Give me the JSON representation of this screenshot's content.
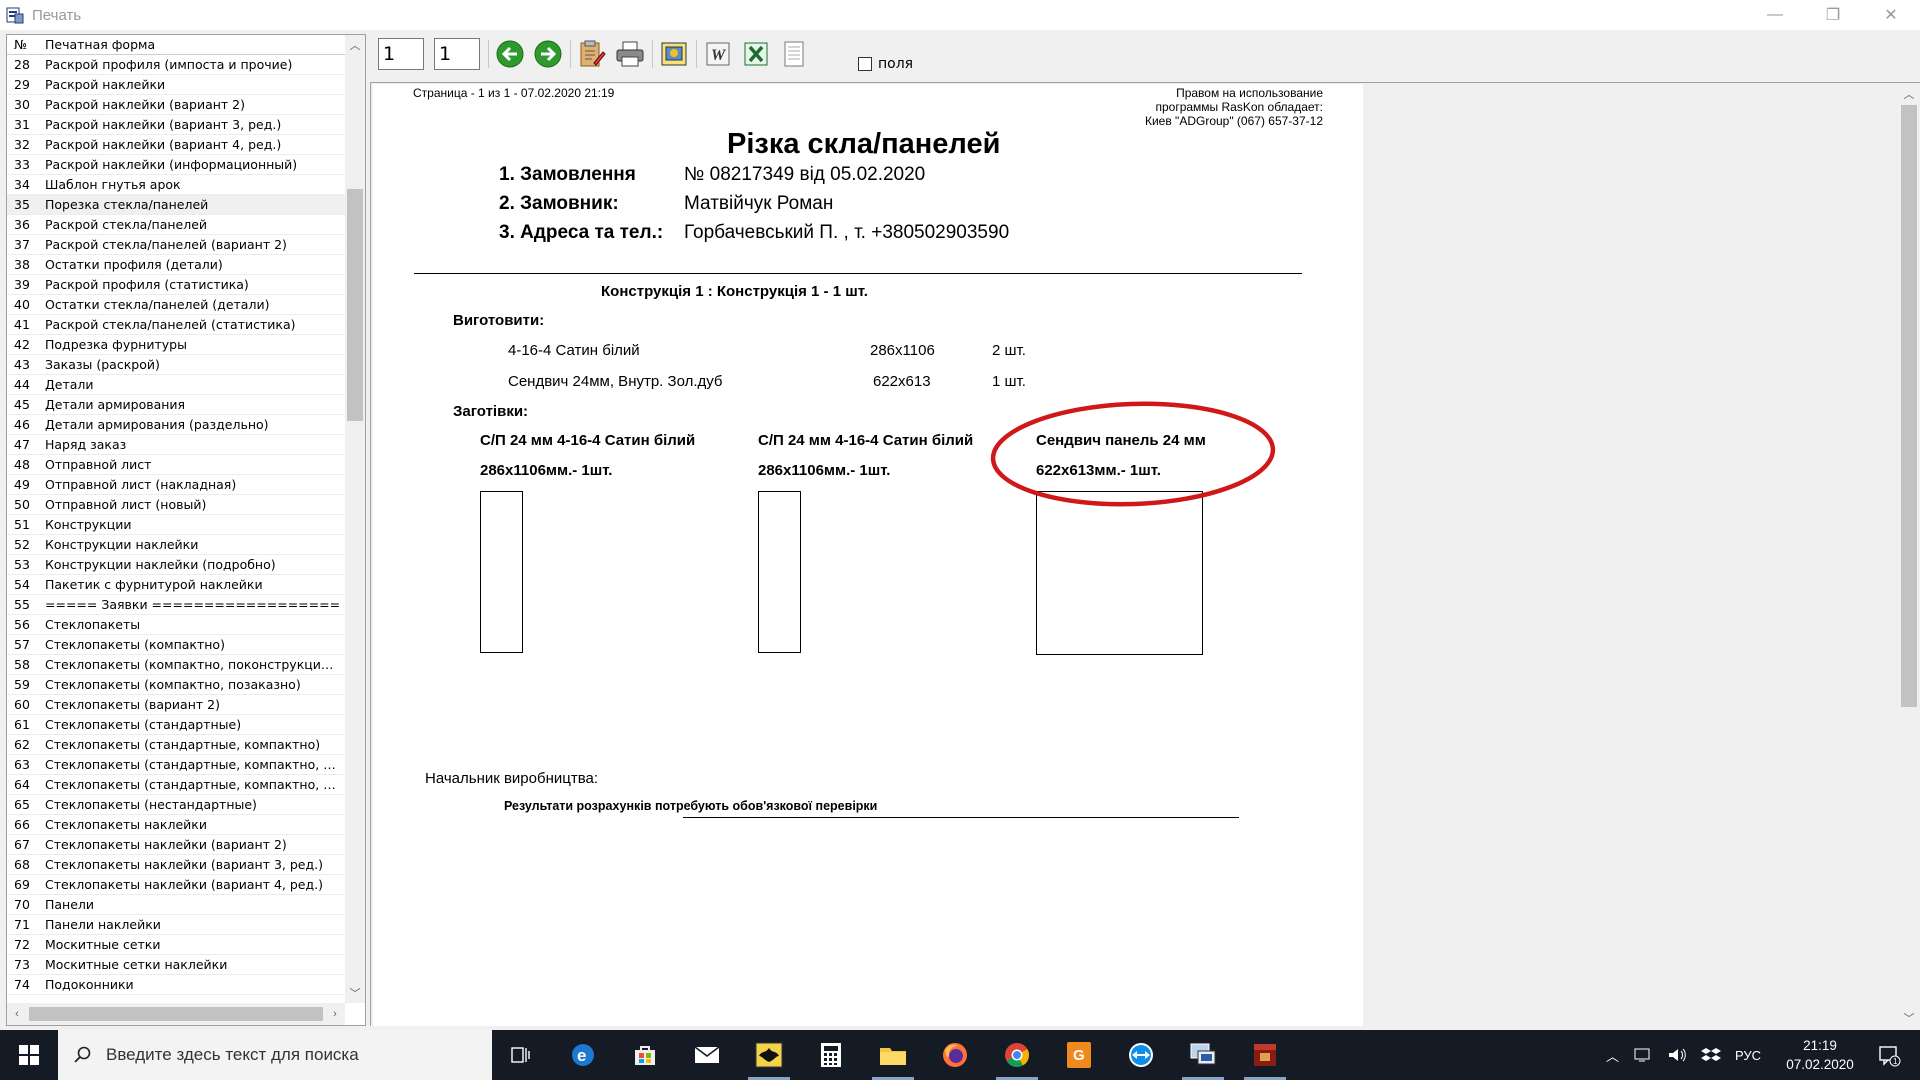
{
  "window": {
    "title": "Печать"
  },
  "list": {
    "header": {
      "num": "№",
      "name": "Печатная форма"
    },
    "rows": [
      {
        "num": "28",
        "name": "Раскрой профиля (импоста и прочие)"
      },
      {
        "num": "29",
        "name": "Раскрой наклейки"
      },
      {
        "num": "30",
        "name": "Раскрой наклейки (вариант 2)"
      },
      {
        "num": "31",
        "name": "Раскрой наклейки (вариант 3, ред.)"
      },
      {
        "num": "32",
        "name": "Раскрой наклейки (вариант 4, ред.)"
      },
      {
        "num": "33",
        "name": "Раскрой наклейки (информационный)"
      },
      {
        "num": "34",
        "name": "Шаблон гнутья арок"
      },
      {
        "num": "35",
        "name": "Порезка стекла/панелей"
      },
      {
        "num": "36",
        "name": "Раскрой стекла/панелей"
      },
      {
        "num": "37",
        "name": "Раскрой стекла/панелей (вариант 2)"
      },
      {
        "num": "38",
        "name": "Остатки профиля (детали)"
      },
      {
        "num": "39",
        "name": "Раскрой профиля (статистика)"
      },
      {
        "num": "40",
        "name": "Остатки стекла/панелей (детали)"
      },
      {
        "num": "41",
        "name": "Раскрой стекла/панелей (статистика)"
      },
      {
        "num": "42",
        "name": "Подрезка фурнитуры"
      },
      {
        "num": "43",
        "name": "Заказы (раскрой)"
      },
      {
        "num": "44",
        "name": "Детали"
      },
      {
        "num": "45",
        "name": "Детали армирования"
      },
      {
        "num": "46",
        "name": "Детали армирования (раздельно)"
      },
      {
        "num": "47",
        "name": "Наряд заказ"
      },
      {
        "num": "48",
        "name": "Отправной лист"
      },
      {
        "num": "49",
        "name": "Отправной лист (накладная)"
      },
      {
        "num": "50",
        "name": "Отправной лист (новый)"
      },
      {
        "num": "51",
        "name": "Конструкции"
      },
      {
        "num": "52",
        "name": "Конструкции наклейки"
      },
      {
        "num": "53",
        "name": "Конструкции наклейки (подробно)"
      },
      {
        "num": "54",
        "name": "Пакетик с фурнитурой наклейки"
      },
      {
        "num": "55",
        "name": "===== Заявки =================="
      },
      {
        "num": "56",
        "name": "Стеклопакеты"
      },
      {
        "num": "57",
        "name": "Стеклопакеты (компактно)"
      },
      {
        "num": "58",
        "name": "Стеклопакеты (компактно, поконструкционно)"
      },
      {
        "num": "59",
        "name": "Стеклопакеты (компактно, позаказно)"
      },
      {
        "num": "60",
        "name": "Стеклопакеты (вариант 2)"
      },
      {
        "num": "61",
        "name": "Стеклопакеты (стандартные)"
      },
      {
        "num": "62",
        "name": "Стеклопакеты (стандартные, компактно)"
      },
      {
        "num": "63",
        "name": "Стеклопакеты (стандартные, компактно, поко..."
      },
      {
        "num": "64",
        "name": "Стеклопакеты (стандартные, компактно, позак..."
      },
      {
        "num": "65",
        "name": "Стеклопакеты (нестандартные)"
      },
      {
        "num": "66",
        "name": "Стеклопакеты наклейки"
      },
      {
        "num": "67",
        "name": "Стеклопакеты наклейки (вариант 2)"
      },
      {
        "num": "68",
        "name": "Стеклопакеты наклейки (вариант 3, ред.)"
      },
      {
        "num": "69",
        "name": "Стеклопакеты наклейки (вариант 4, ред.)"
      },
      {
        "num": "70",
        "name": "Панели"
      },
      {
        "num": "71",
        "name": "Панели наклейки"
      },
      {
        "num": "72",
        "name": "Москитные сетки"
      },
      {
        "num": "73",
        "name": "Москитные сетки наклейки"
      },
      {
        "num": "74",
        "name": "Подоконники"
      }
    ],
    "selected_num": "35"
  },
  "toolbar": {
    "page_from": "1",
    "page_to": "1",
    "fields_label": "поля"
  },
  "report": {
    "page_info": "Страница  - 1 из 1 -  07.02.2020 21:19",
    "license_line1": "Правом на использование",
    "license_line2": "программы RasKon обладает:",
    "license_line3": "Киев  \"ADGroup\"  (067) 657-37-12",
    "title": "Різка скла/панелей",
    "order_label": "1. Замовлення",
    "order_value": "№ 08217349  від 05.02.2020",
    "customer_label": "2. Замовник:",
    "customer_value": "Матвійчук Роман",
    "address_label": "3. Адреса та тел.:",
    "address_value": "Горбачевський П. , т. +380502903590",
    "construction": "Конструкція 1 : Конструкція 1 - 1 шт.",
    "make_label": "Виготовити:",
    "make_items": [
      {
        "name": "4-16-4 Сатин білий",
        "size": "286x1106",
        "qty": "2 шт."
      },
      {
        "name": "Сендвич 24мм, Внутр. Зол.дуб",
        "size": "622x613",
        "qty": "1 шт."
      }
    ],
    "blanks_label": "Заготівки:",
    "blanks": [
      {
        "title": "С/П 24 мм 4-16-4 Сатин білий",
        "size": "286x1106мм.- 1шт."
      },
      {
        "title": "С/П 24 мм 4-16-4 Сатин білий",
        "size": "286x1106мм.- 1шт."
      },
      {
        "title": "Сендвич панель 24 мм",
        "size": "622x613мм.- 1шт."
      }
    ],
    "chief_label": "Начальник виробництва:",
    "footer_note": "Результати розрахунків потребують обов'язкової перевірки"
  },
  "taskbar": {
    "search_placeholder": "Введите здесь текст для поиска",
    "lang": "РУС",
    "time": "21:19",
    "date": "07.02.2020",
    "notif_count": "1"
  },
  "colors": {
    "annotation": "#d01818",
    "taskbar": "#141b24",
    "accent_green": "#2e9a2e"
  }
}
